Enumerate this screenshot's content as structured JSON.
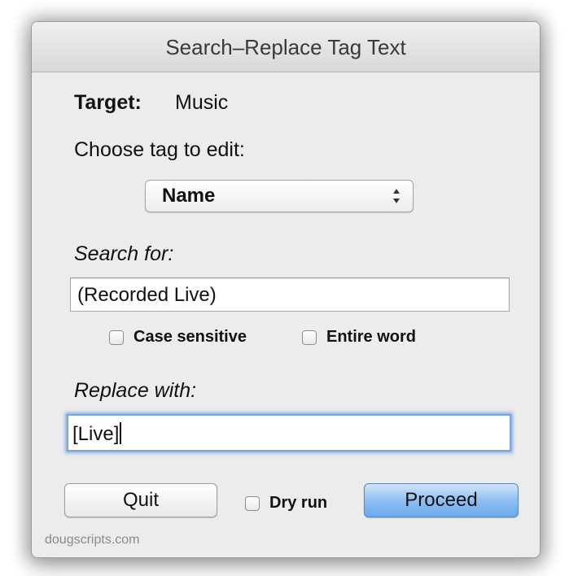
{
  "window": {
    "title": "Search–Replace Tag Text"
  },
  "target": {
    "label": "Target:",
    "value": "Music"
  },
  "tag_chooser": {
    "label": "Choose tag to edit:",
    "selected": "Name"
  },
  "search": {
    "label": "Search for:",
    "value": "(Recorded Live)",
    "case_sensitive": {
      "label": "Case sensitive",
      "checked": false
    },
    "entire_word": {
      "label": "Entire word",
      "checked": false
    }
  },
  "replace": {
    "label": "Replace with:",
    "value": "[Live]",
    "focused": true
  },
  "actions": {
    "quit_label": "Quit",
    "dry_run": {
      "label": "Dry run",
      "checked": false
    },
    "proceed_label": "Proceed"
  },
  "footer": {
    "credit": "dougscripts.com"
  },
  "colors": {
    "default_button": "#8ec0f2",
    "focus_ring": "#7aa6dd",
    "window_bg": "#ececec"
  }
}
